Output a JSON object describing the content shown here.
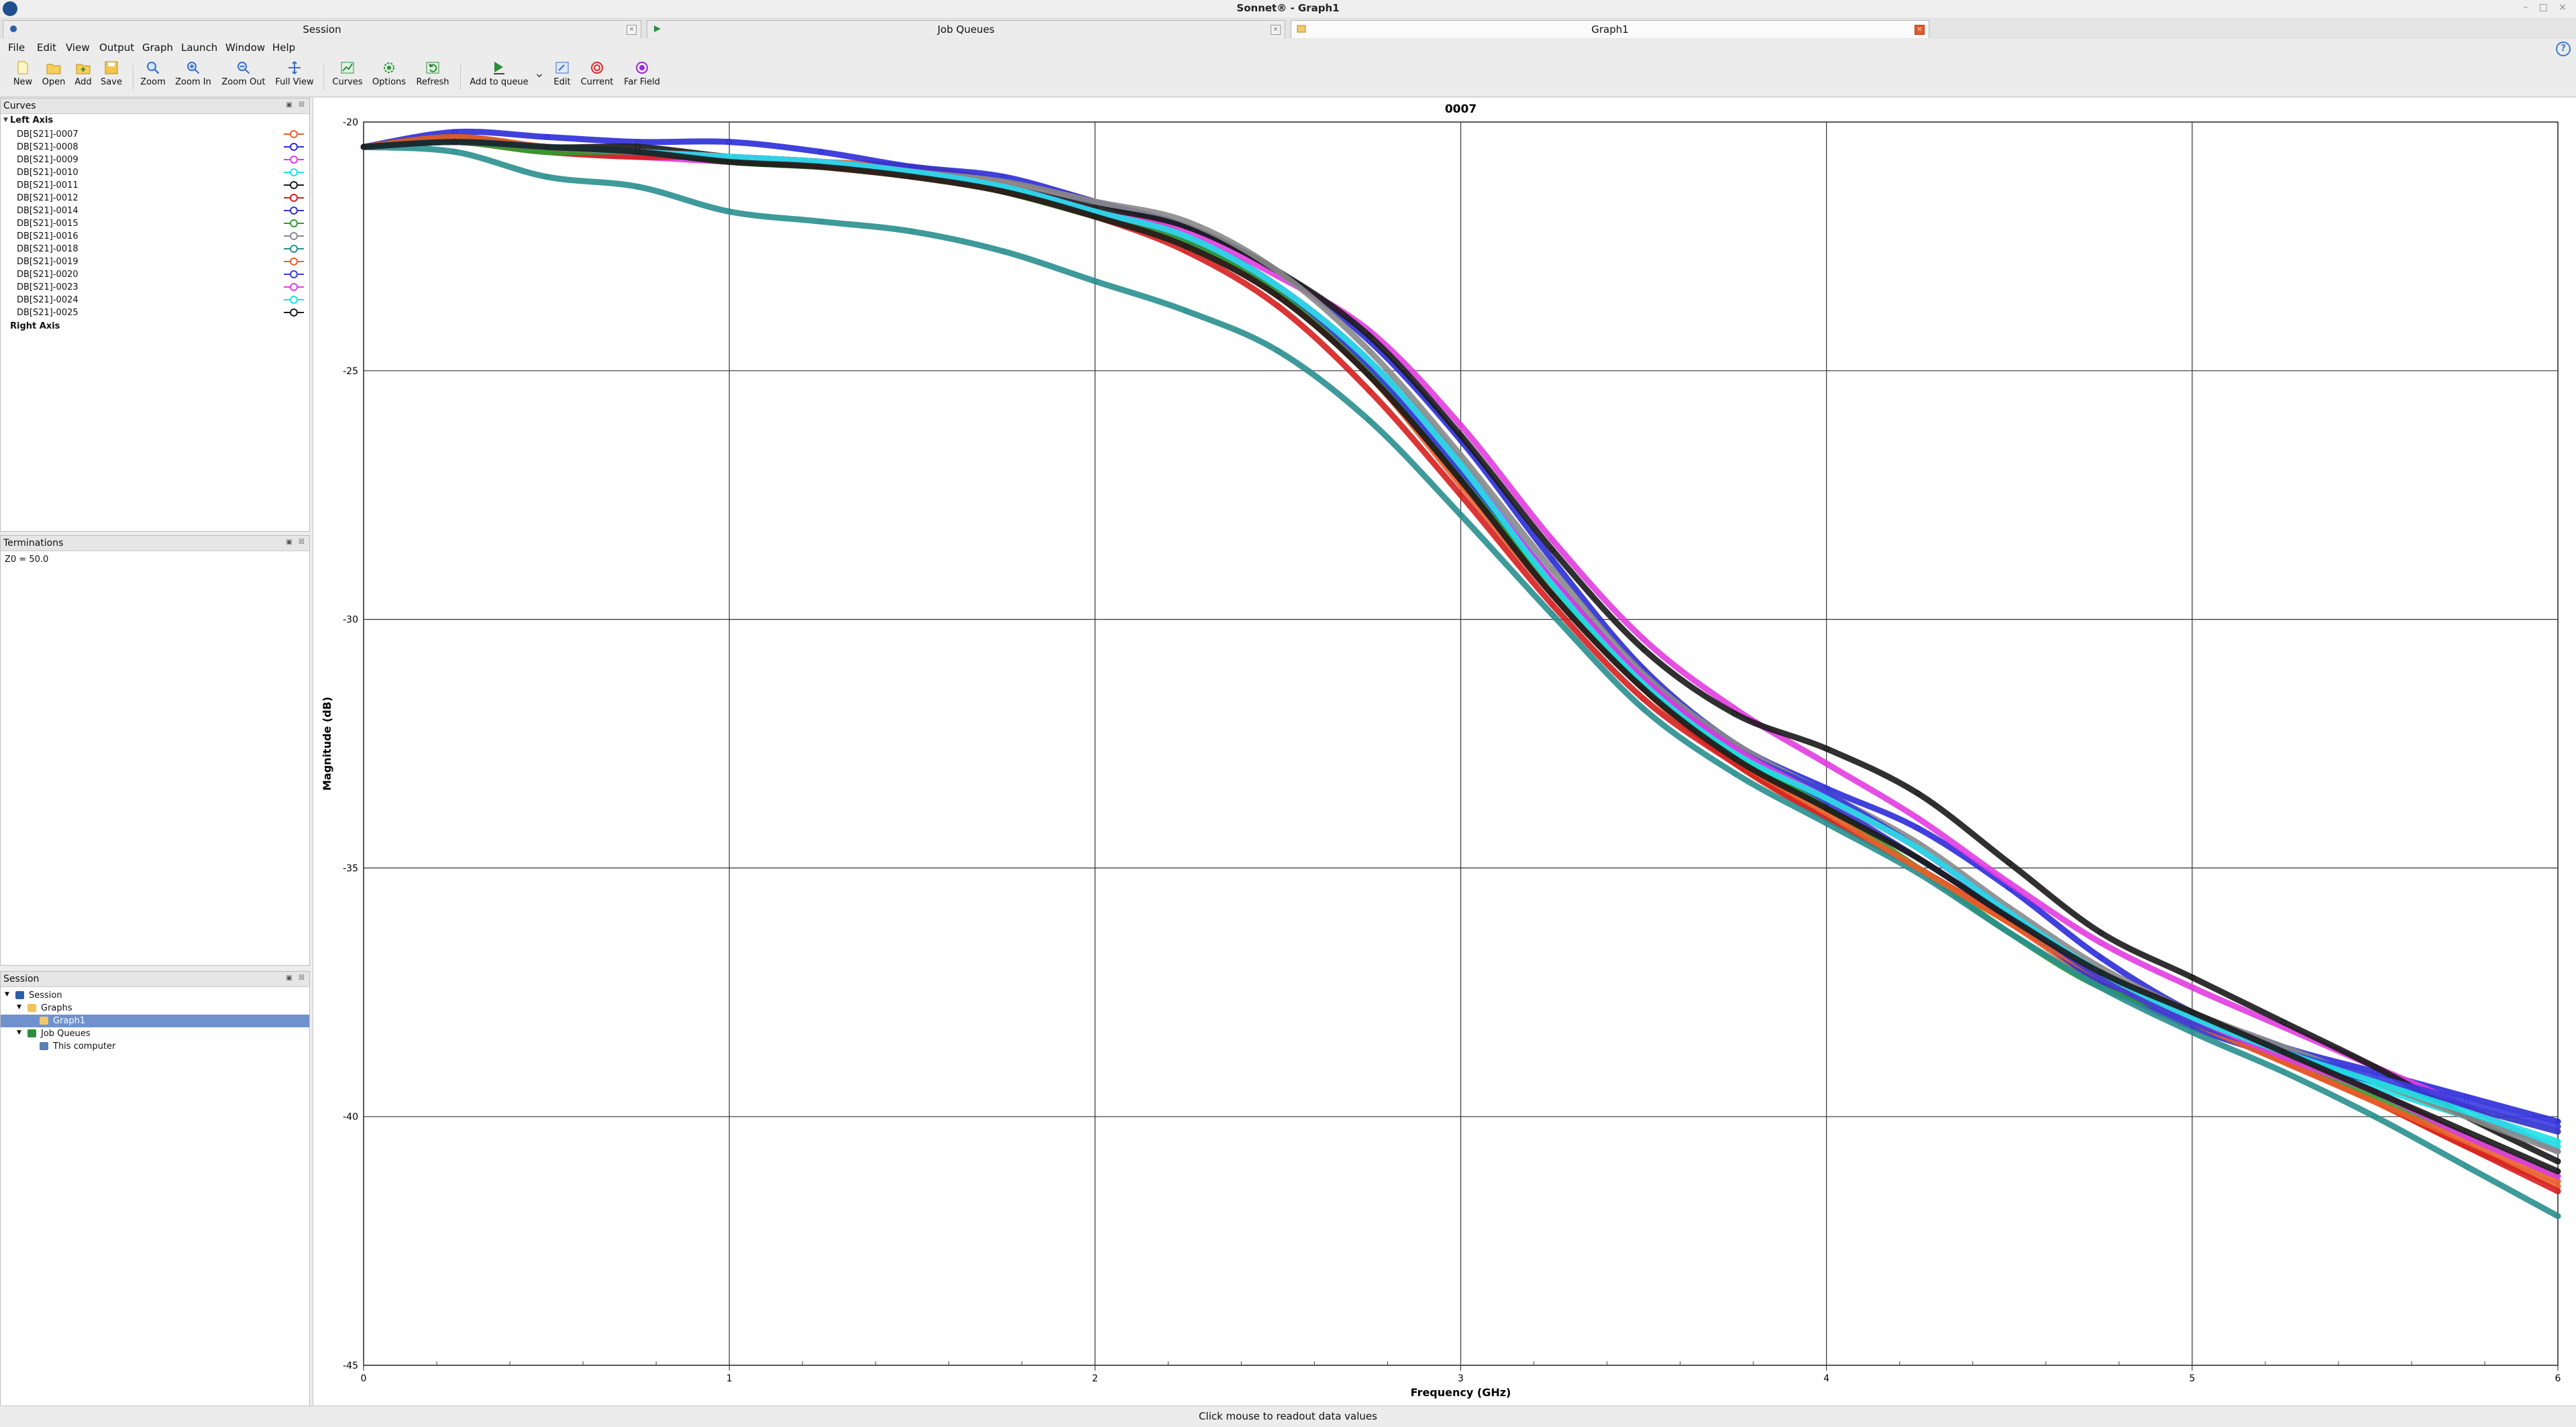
{
  "window": {
    "title": "Sonnet® - Graph1"
  },
  "tabs": [
    {
      "label": "Session",
      "active": false
    },
    {
      "label": "Job Queues",
      "active": false
    },
    {
      "label": "Graph1",
      "active": true
    }
  ],
  "menu": [
    "File",
    "Edit",
    "View",
    "Output",
    "Graph",
    "Launch",
    "Window",
    "Help"
  ],
  "toolbar": [
    {
      "label": "New",
      "icon": "new-file-icon"
    },
    {
      "label": "Open",
      "icon": "open-folder-icon"
    },
    {
      "label": "Add",
      "icon": "add-folder-icon"
    },
    {
      "label": "Save",
      "icon": "save-icon"
    },
    {
      "label": "Zoom",
      "icon": "zoom-icon"
    },
    {
      "label": "Zoom In",
      "icon": "zoom-in-icon"
    },
    {
      "label": "Zoom Out",
      "icon": "zoom-out-icon"
    },
    {
      "label": "Full View",
      "icon": "full-view-icon"
    },
    {
      "label": "Curves",
      "icon": "curves-icon"
    },
    {
      "label": "Options",
      "icon": "options-gear-icon"
    },
    {
      "label": "Refresh",
      "icon": "refresh-icon"
    },
    {
      "label": "Add to queue",
      "icon": "add-to-queue-icon"
    },
    {
      "label": "Edit",
      "icon": "edit-icon"
    },
    {
      "label": "Current",
      "icon": "current-icon"
    },
    {
      "label": "Far Field",
      "icon": "far-field-icon"
    }
  ],
  "curves_panel": {
    "title": "Curves",
    "left_axis_label": "Left Axis",
    "right_axis_label": "Right Axis",
    "curves": [
      {
        "name": "DB[S21]-0007",
        "color": "#e8602c"
      },
      {
        "name": "DB[S21]-0008",
        "color": "#2c2cd8"
      },
      {
        "name": "DB[S21]-0009",
        "color": "#e23ce0"
      },
      {
        "name": "DB[S21]-0010",
        "color": "#1fe0e6"
      },
      {
        "name": "DB[S21]-0011",
        "color": "#1a1a1a"
      },
      {
        "name": "DB[S21]-0012",
        "color": "#d62020"
      },
      {
        "name": "DB[S21]-0014",
        "color": "#3232c8"
      },
      {
        "name": "DB[S21]-0015",
        "color": "#2e9e2e"
      },
      {
        "name": "DB[S21]-0016",
        "color": "#8a8a8a"
      },
      {
        "name": "DB[S21]-0018",
        "color": "#2a8f8f"
      },
      {
        "name": "DB[S21]-0019",
        "color": "#e8602c"
      },
      {
        "name": "DB[S21]-0020",
        "color": "#3b3be0"
      },
      {
        "name": "DB[S21]-0023",
        "color": "#e23ce0"
      },
      {
        "name": "DB[S21]-0024",
        "color": "#1fe0e6"
      },
      {
        "name": "DB[S21]-0025",
        "color": "#1a1a1a"
      }
    ]
  },
  "terminations_panel": {
    "title": "Terminations",
    "text": "Z0 = 50.0"
  },
  "session_panel": {
    "title": "Session",
    "tree": [
      {
        "label": "Session",
        "level": 0,
        "icon": "session-icon"
      },
      {
        "label": "Graphs",
        "level": 1,
        "icon": "folder-icon"
      },
      {
        "label": "Graph1",
        "level": 2,
        "icon": "graph-icon",
        "selected": true
      },
      {
        "label": "Job Queues",
        "level": 1,
        "icon": "job-queue-icon"
      },
      {
        "label": "This computer",
        "level": 2,
        "icon": "computer-icon"
      }
    ]
  },
  "status_text": "Click mouse to readout data values",
  "chart_data": {
    "type": "line",
    "title": "0007",
    "xlabel": "Frequency (GHz)",
    "ylabel": "Magnitude (dB)",
    "xlim": [
      0,
      6
    ],
    "ylim": [
      -45,
      -20
    ],
    "xticks": [
      "0",
      "1",
      "2",
      "3",
      "4",
      "5",
      "6"
    ],
    "yticks": [
      "-20",
      "-25",
      "-30",
      "-35",
      "-40",
      "-45"
    ],
    "grid": true,
    "x": [
      0,
      0.25,
      0.5,
      0.75,
      1.0,
      1.25,
      1.5,
      1.75,
      2.0,
      2.25,
      2.5,
      2.75,
      3.0,
      3.25,
      3.5,
      3.75,
      4.0,
      4.25,
      4.5,
      4.75,
      5.0,
      5.25,
      5.5,
      5.75,
      6.0
    ],
    "series": [
      {
        "name": "DB[S21]-0007",
        "color": "#e8602c",
        "values": [
          -20.5,
          -20.4,
          -20.6,
          -20.6,
          -20.7,
          -20.8,
          -20.9,
          -21.2,
          -21.6,
          -22.3,
          -23.4,
          -25.1,
          -27.2,
          -29.4,
          -31.4,
          -32.9,
          -34.0,
          -35.0,
          -36.1,
          -37.3,
          -38.1,
          -38.9,
          -39.7,
          -40.6,
          -41.4
        ]
      },
      {
        "name": "DB[S21]-0008",
        "color": "#2c2cd8",
        "values": [
          -20.5,
          -20.2,
          -20.3,
          -20.4,
          -20.4,
          -20.6,
          -20.9,
          -21.1,
          -21.6,
          -22.1,
          -23.0,
          -24.4,
          -26.4,
          -28.8,
          -31.0,
          -32.5,
          -33.4,
          -34.2,
          -35.4,
          -36.8,
          -37.9,
          -38.6,
          -39.1,
          -39.6,
          -40.1
        ]
      },
      {
        "name": "DB[S21]-0009",
        "color": "#e23ce0",
        "values": [
          -20.5,
          -20.4,
          -20.6,
          -20.7,
          -20.8,
          -20.9,
          -21.0,
          -21.4,
          -21.8,
          -22.2,
          -23.1,
          -24.2,
          -26.1,
          -28.4,
          -30.4,
          -31.8,
          -32.9,
          -34.0,
          -35.3,
          -36.5,
          -37.4,
          -38.2,
          -39.0,
          -39.8,
          -40.7
        ]
      },
      {
        "name": "DB[S21]-0010",
        "color": "#1fe0e6",
        "values": [
          -20.5,
          -20.4,
          -20.5,
          -20.6,
          -20.7,
          -20.9,
          -21.0,
          -21.3,
          -21.8,
          -22.3,
          -23.3,
          -24.8,
          -26.8,
          -29.2,
          -31.3,
          -32.6,
          -33.6,
          -34.6,
          -35.9,
          -37.1,
          -38.0,
          -38.7,
          -39.4,
          -40.0,
          -40.6
        ]
      },
      {
        "name": "DB[S21]-0011",
        "color": "#1a1a1a",
        "values": [
          -20.5,
          -20.3,
          -20.5,
          -20.5,
          -20.7,
          -20.8,
          -21.0,
          -21.3,
          -21.7,
          -22.1,
          -23.0,
          -24.3,
          -26.3,
          -28.6,
          -30.6,
          -31.9,
          -32.6,
          -33.5,
          -34.9,
          -36.3,
          -37.2,
          -38.1,
          -39.0,
          -40.0,
          -40.9
        ]
      },
      {
        "name": "DB[S21]-0012",
        "color": "#d62020",
        "values": [
          -20.5,
          -20.4,
          -20.6,
          -20.7,
          -20.7,
          -20.9,
          -21.0,
          -21.4,
          -21.9,
          -22.6,
          -23.7,
          -25.4,
          -27.5,
          -29.7,
          -31.6,
          -32.9,
          -34.0,
          -35.0,
          -36.1,
          -37.2,
          -38.1,
          -38.9,
          -39.7,
          -40.6,
          -41.5
        ]
      },
      {
        "name": "DB[S21]-0014",
        "color": "#3232c8",
        "values": [
          -20.5,
          -20.4,
          -20.5,
          -20.6,
          -20.7,
          -20.8,
          -21.0,
          -21.3,
          -21.8,
          -22.4,
          -23.4,
          -25.0,
          -27.0,
          -29.3,
          -31.3,
          -32.8,
          -33.7,
          -34.8,
          -36.0,
          -37.3,
          -38.2,
          -38.8,
          -39.3,
          -39.8,
          -40.3
        ]
      },
      {
        "name": "DB[S21]-0015",
        "color": "#2e9e2e",
        "values": [
          -20.5,
          -20.4,
          -20.6,
          -20.6,
          -20.8,
          -20.9,
          -21.0,
          -21.4,
          -21.9,
          -22.4,
          -23.4,
          -25.0,
          -27.1,
          -29.3,
          -31.3,
          -32.7,
          -33.8,
          -35.0,
          -36.3,
          -37.4,
          -38.0,
          -38.8,
          -39.6,
          -40.4,
          -41.2
        ]
      },
      {
        "name": "DB[S21]-0016",
        "color": "#8a8a8a",
        "values": [
          -20.5,
          -20.4,
          -20.5,
          -20.6,
          -20.7,
          -20.8,
          -21.0,
          -21.2,
          -21.6,
          -22.0,
          -23.0,
          -24.6,
          -26.7,
          -29.0,
          -31.1,
          -32.5,
          -33.5,
          -34.5,
          -35.8,
          -37.0,
          -37.9,
          -38.6,
          -39.3,
          -40.0,
          -40.7
        ]
      },
      {
        "name": "DB[S21]-0018",
        "color": "#2a8f8f",
        "values": [
          -20.5,
          -20.6,
          -21.1,
          -21.3,
          -21.8,
          -22.0,
          -22.2,
          -22.6,
          -23.2,
          -23.8,
          -24.6,
          -26.0,
          -27.9,
          -29.9,
          -31.8,
          -33.1,
          -34.1,
          -35.1,
          -36.3,
          -37.4,
          -38.3,
          -39.1,
          -40.0,
          -41.0,
          -42.0
        ]
      },
      {
        "name": "DB[S21]-0019",
        "color": "#e8602c",
        "values": [
          -20.5,
          -20.3,
          -20.5,
          -20.6,
          -20.7,
          -20.9,
          -21.1,
          -21.4,
          -21.9,
          -22.5,
          -23.5,
          -25.1,
          -27.3,
          -29.5,
          -31.4,
          -32.8,
          -33.9,
          -35.0,
          -36.1,
          -37.2,
          -38.1,
          -38.9,
          -39.7,
          -40.5,
          -41.3
        ]
      },
      {
        "name": "DB[S21]-0020",
        "color": "#3b3be0",
        "values": [
          -20.5,
          -20.4,
          -20.5,
          -20.6,
          -20.7,
          -20.8,
          -21.0,
          -21.3,
          -21.8,
          -22.3,
          -23.3,
          -24.9,
          -27.0,
          -29.2,
          -31.2,
          -32.6,
          -33.5,
          -34.6,
          -35.9,
          -37.2,
          -38.1,
          -38.7,
          -39.2,
          -39.7,
          -40.2
        ]
      },
      {
        "name": "DB[S21]-0023",
        "color": "#e23ce0",
        "values": [
          -20.5,
          -20.4,
          -20.5,
          -20.6,
          -20.7,
          -20.8,
          -21.0,
          -21.3,
          -21.8,
          -22.3,
          -23.3,
          -24.8,
          -26.9,
          -29.2,
          -31.2,
          -32.6,
          -33.6,
          -34.6,
          -35.9,
          -37.1,
          -38.0,
          -38.8,
          -39.5,
          -40.4,
          -41.2
        ]
      },
      {
        "name": "DB[S21]-0024",
        "color": "#1fe0e6",
        "values": [
          -20.5,
          -20.4,
          -20.5,
          -20.6,
          -20.7,
          -20.8,
          -21.0,
          -21.3,
          -21.8,
          -22.3,
          -23.3,
          -24.8,
          -26.9,
          -29.3,
          -31.3,
          -32.7,
          -33.6,
          -34.6,
          -35.9,
          -37.1,
          -38.0,
          -38.7,
          -39.3,
          -39.9,
          -40.5
        ]
      },
      {
        "name": "DB[S21]-0025",
        "color": "#1a1a1a",
        "values": [
          -20.5,
          -20.4,
          -20.5,
          -20.6,
          -20.8,
          -20.9,
          -21.1,
          -21.4,
          -21.9,
          -22.5,
          -23.5,
          -25.1,
          -27.2,
          -29.5,
          -31.4,
          -32.8,
          -33.8,
          -34.8,
          -36.0,
          -37.1,
          -37.9,
          -38.7,
          -39.5,
          -40.3,
          -41.1
        ]
      }
    ]
  }
}
